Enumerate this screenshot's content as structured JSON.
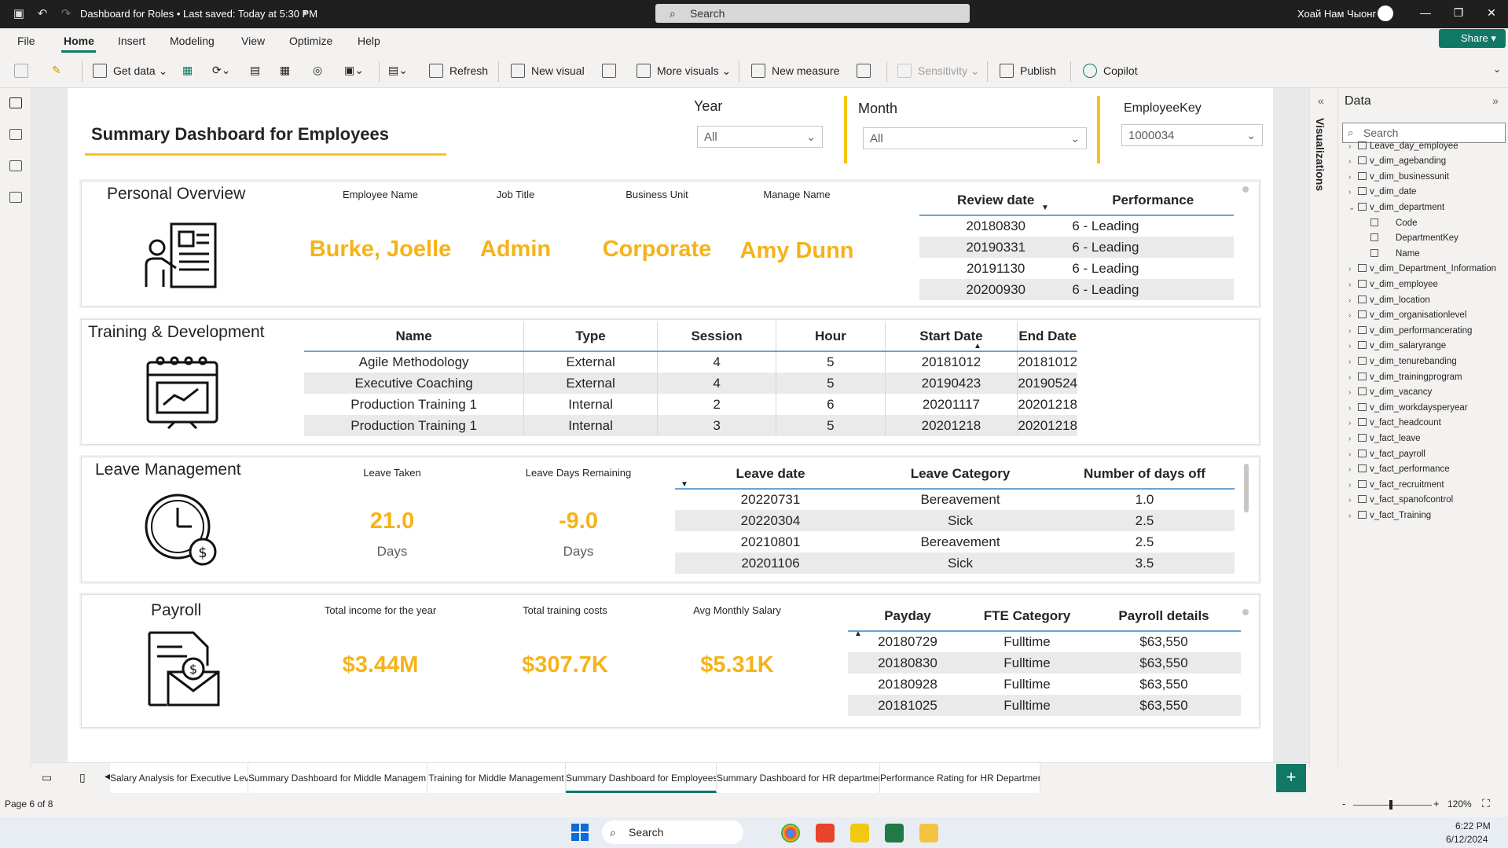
{
  "titlebar": {
    "doc_title": "Dashboard for Roles • Last saved: Today at 5:30 PM",
    "search_placeholder": "Search",
    "user": "Хоай Нам Чыонг"
  },
  "menu": [
    "File",
    "Home",
    "Insert",
    "Modeling",
    "View",
    "Optimize",
    "Help"
  ],
  "share_label": "Share",
  "toolbar": {
    "get_data": "Get data",
    "refresh": "Refresh",
    "new_visual": "New visual",
    "more_visuals": "More visuals",
    "new_measure": "New measure",
    "sensitivity": "Sensitivity",
    "publish": "Publish",
    "copilot": "Copilot"
  },
  "report": {
    "title": "Summary Dashboard for Employees",
    "slicers": {
      "year": {
        "label": "Year",
        "value": "All"
      },
      "month": {
        "label": "Month",
        "value": "All"
      },
      "employee_key": {
        "label": "EmployeeKey",
        "value": "1000034"
      }
    },
    "personal": {
      "title": "Personal Overview",
      "labels": [
        "Employee Name",
        "Job Title",
        "Business Unit",
        "Manage Name"
      ],
      "values": [
        "Burke, Joelle",
        "Admin",
        "Corporate",
        "Amy Dunn"
      ],
      "table": {
        "headers": [
          "Review date",
          "Performance"
        ],
        "rows": [
          [
            "20180830",
            "6 - Leading"
          ],
          [
            "20190331",
            "6 - Leading"
          ],
          [
            "20191130",
            "6 - Leading"
          ],
          [
            "20200930",
            "6 - Leading"
          ]
        ]
      }
    },
    "training": {
      "title": "Training & Development",
      "headers": [
        "Name",
        "Type",
        "Session",
        "Hour",
        "Start Date",
        "End Date"
      ],
      "rows": [
        [
          "Agile Methodology",
          "External",
          "4",
          "5",
          "20181012",
          "20181012"
        ],
        [
          "Executive Coaching",
          "External",
          "4",
          "5",
          "20190423",
          "20190524"
        ],
        [
          "Production Training 1",
          "Internal",
          "2",
          "6",
          "20201117",
          "20201218"
        ],
        [
          "Production Training 1",
          "Internal",
          "3",
          "5",
          "20201218",
          "20201218"
        ]
      ]
    },
    "leave": {
      "title": "Leave Management",
      "taken_label": "Leave Taken",
      "taken_value": "21.0",
      "taken_unit": "Days",
      "remaining_label": "Leave Days Remaining",
      "remaining_value": "-9.0",
      "remaining_unit": "Days",
      "headers": [
        "Leave date",
        "Leave Category",
        "Number of days off"
      ],
      "rows": [
        [
          "20220731",
          "Bereavement",
          "1.0"
        ],
        [
          "20220304",
          "Sick",
          "2.5"
        ],
        [
          "20210801",
          "Bereavement",
          "2.5"
        ],
        [
          "20201106",
          "Sick",
          "3.5"
        ]
      ]
    },
    "payroll": {
      "title": "Payroll",
      "labels": [
        "Total income for the year",
        "Total training costs",
        "Avg Monthly Salary"
      ],
      "values": [
        "$3.44M",
        "$307.7K",
        "$5.31K"
      ],
      "headers": [
        "Payday",
        "FTE Category",
        "Payroll details"
      ],
      "rows": [
        [
          "20180729",
          "Fulltime",
          "$63,550"
        ],
        [
          "20180830",
          "Fulltime",
          "$63,550"
        ],
        [
          "20180928",
          "Fulltime",
          "$63,550"
        ],
        [
          "20181025",
          "Fulltime",
          "$63,550"
        ]
      ]
    }
  },
  "viz_label": "Visualizations",
  "data_pane": {
    "title": "Data",
    "search_placeholder": "Search",
    "tables_top": [
      "Leave_day_employee",
      "v_dim_agebanding",
      "v_dim_businessunit",
      "v_dim_date",
      "v_dim_department"
    ],
    "department_fields": [
      "Code",
      "DepartmentKey",
      "Name"
    ],
    "tables_bottom": [
      "v_dim_Department_Information",
      "v_dim_employee",
      "v_dim_location",
      "v_dim_organisationlevel",
      "v_dim_performancerating",
      "v_dim_salaryrange",
      "v_dim_tenurebanding",
      "v_dim_trainingprogram",
      "v_dim_vacancy",
      "v_dim_workdaysperyear",
      "v_fact_headcount",
      "v_fact_leave",
      "v_fact_payroll",
      "v_fact_performance",
      "v_fact_recruitment",
      "v_fact_spanofcontrol",
      "v_fact_Training"
    ]
  },
  "page_tabs": [
    "Salary Analysis for Executive Level",
    "Summary Dashboard for Middle Managem...",
    "Training for Middle Management",
    "Summary Dashboard for Employees",
    "Summary Dashboard for HR department",
    "Performance Rating for HR Department"
  ],
  "active_tab": "Summary Dashboard for Employees",
  "status": {
    "page": "Page 6 of 8",
    "zoom": "120%"
  },
  "taskbar": {
    "search": "Search",
    "time": "6:22 PM",
    "date": "6/12/2024"
  },
  "colors": {
    "accent": "#117865",
    "kpi": "#f5b31a",
    "gold_line": "#f5c518",
    "table_rule": "#6aa3d5"
  }
}
